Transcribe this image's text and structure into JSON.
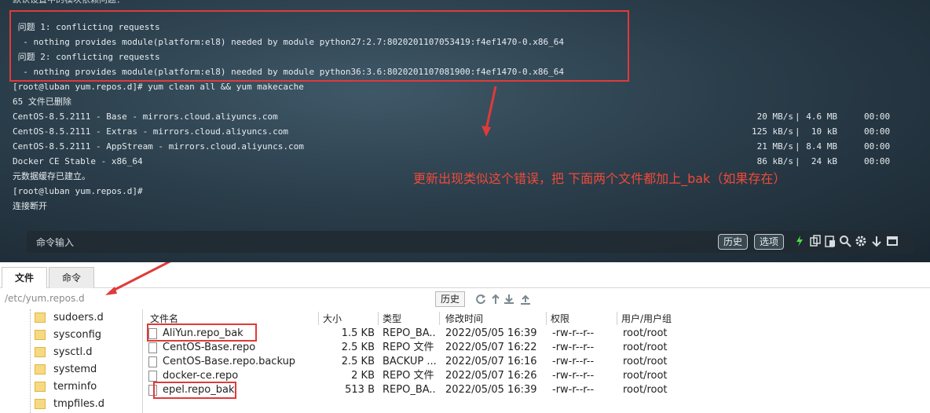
{
  "terminal": {
    "top_partial": "默认设置中的模块依赖问题：",
    "error_lines": [
      " 问题 1: conflicting requests",
      "  - nothing provides module(platform:el8) needed by module python27:2.7:8020201107053419:f4ef1470-0.x86_64",
      " 问题 2: conflicting requests",
      "  - nothing provides module(platform:el8) needed by module python36:3.6:8020201107081900:f4ef1470-0.x86_64"
    ],
    "command_line": "[root@luban yum.repos.d]# yum clean all && yum makecache",
    "deleted_line": "65 文件已删除",
    "repos": [
      {
        "name": "CentOS-8.5.2111 - Base - mirrors.cloud.aliyuncs.com",
        "rate": "20 MB/s",
        "sep": "|",
        "size": "4.6 MB",
        "time": "00:00"
      },
      {
        "name": "CentOS-8.5.2111 - Extras - mirrors.cloud.aliyuncs.com",
        "rate": "125 kB/s",
        "sep": "|",
        "size": "10 kB",
        "time": "00:00"
      },
      {
        "name": "CentOS-8.5.2111 - AppStream - mirrors.cloud.aliyuncs.com",
        "rate": "21 MB/s",
        "sep": "|",
        "size": "8.4 MB",
        "time": "00:00"
      },
      {
        "name": "Docker CE Stable - x86_64",
        "rate": "86 kB/s",
        "sep": "|",
        "size": "24 kB",
        "time": "00:00"
      }
    ],
    "cache_line": "元数据缓存已建立。",
    "prompt_line": "[root@luban yum.repos.d]#",
    "disconnect_line": "连接断开",
    "annotation": "更新出现类似这个错误，把 下面两个文件都加上_bak（如果存在）",
    "colors": {
      "annotation": "#f04a3a",
      "box": "#e03a3a"
    }
  },
  "command_bar": {
    "placeholder": "命令输入",
    "history_label": "历史",
    "options_label": "选项"
  },
  "file_panel": {
    "tabs": [
      "文件",
      "命令"
    ],
    "path": "/etc/yum.repos.d",
    "history_label": "历史",
    "tree_items": [
      "sudoers.d",
      "sysconfig",
      "sysctl.d",
      "systemd",
      "terminfo",
      "tmpfiles.d"
    ],
    "columns": [
      "文件名",
      "大小",
      "类型",
      "修改时间",
      "权限",
      "用户/用户组"
    ],
    "files": [
      {
        "name": "AliYun.repo_bak",
        "size": "1.5 KB",
        "type": "REPO_BA...",
        "mtime": "2022/05/05 16:39",
        "perm": "-rw-r--r--",
        "owner": "root/root"
      },
      {
        "name": "CentOS-Base.repo",
        "size": "2.5 KB",
        "type": "REPO 文件",
        "mtime": "2022/05/07 16:22",
        "perm": "-rw-r--r--",
        "owner": "root/root"
      },
      {
        "name": "CentOS-Base.repo.backup",
        "size": "2.5 KB",
        "type": "BACKUP ...",
        "mtime": "2022/05/07 16:16",
        "perm": "-rw-r--r--",
        "owner": "root/root"
      },
      {
        "name": "docker-ce.repo",
        "size": "2 KB",
        "type": "REPO 文件",
        "mtime": "2022/05/07 16:26",
        "perm": "-rw-r--r--",
        "owner": "root/root"
      },
      {
        "name": "epel.repo_bak",
        "size": "513 B",
        "type": "REPO_BA...",
        "mtime": "2022/05/05 16:39",
        "perm": "-rw-r--r--",
        "owner": "root/root"
      }
    ]
  }
}
